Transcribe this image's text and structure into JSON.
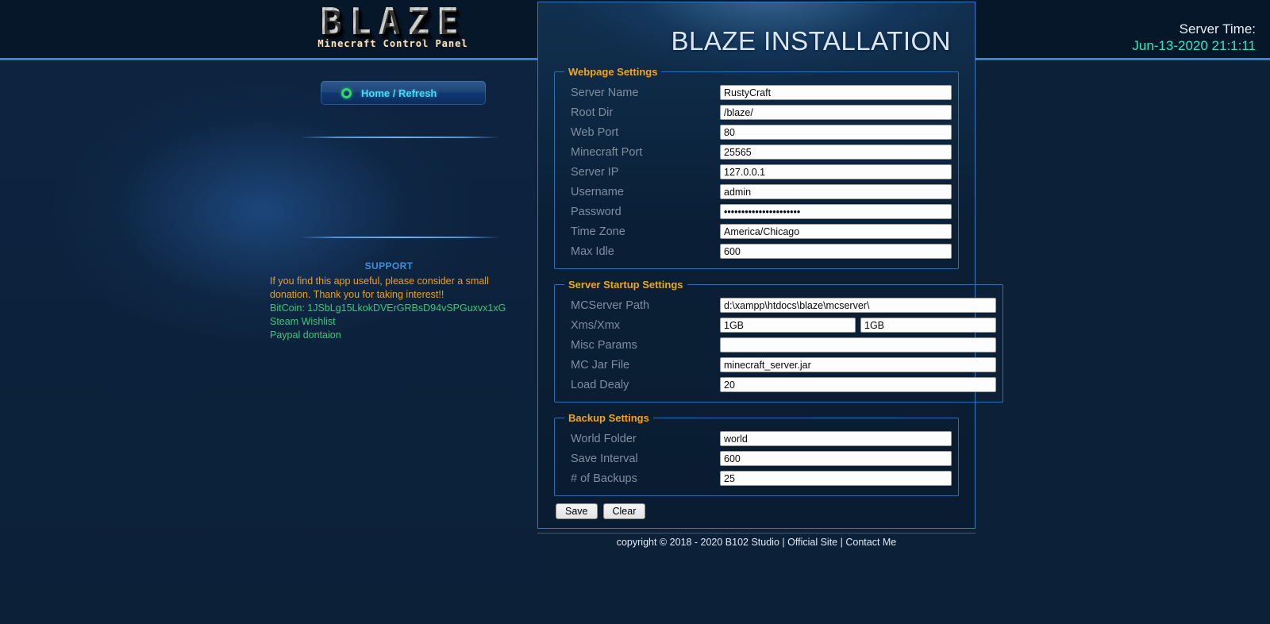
{
  "header": {
    "logo_main": "BLAZE",
    "logo_sub": "Minecraft Control Panel",
    "server_time_label": "Server Time:",
    "server_time_value": "Jun-13-2020 21:1:11"
  },
  "sidebar": {
    "nav": {
      "home_label": "Home / Refresh",
      "home_icon": "green-circle-icon"
    },
    "support": {
      "title": "SUPPORT",
      "note_line1": "If you find this app useful, please consider a small",
      "note_line2": "donation. Thank you for taking interest!!",
      "bitcoin": "BitCoin: 1JSbLg15LkokDVErGRBsD94vSPGuxvx1xG",
      "steam_link": "Steam Wishlist",
      "paypal_link": "Paypal dontaion"
    }
  },
  "main": {
    "title": "BLAZE INSTALLATION",
    "groups": [
      {
        "legend": "Webpage Settings",
        "rows": [
          {
            "label": "Server Name",
            "value": "RustyCraft"
          },
          {
            "label": "Root Dir",
            "value": "/blaze/"
          },
          {
            "label": "Web Port",
            "value": "80"
          },
          {
            "label": "Minecraft Port",
            "value": "25565"
          },
          {
            "label": "Server IP",
            "value": "127.0.0.1"
          },
          {
            "label": "Username",
            "value": "admin"
          },
          {
            "label": "Password",
            "value": "••••••••••••••••••••••"
          },
          {
            "label": "Time Zone",
            "value": "America/Chicago"
          },
          {
            "label": "Max Idle",
            "value": "600"
          }
        ]
      },
      {
        "legend": "Server Startup Settings",
        "rows": [
          {
            "label": "MCServer Path",
            "value": "d:\\xampp\\htdocs\\blaze\\mcserver\\"
          },
          {
            "label": "Xms/Xmx",
            "value": "1GB",
            "value2": "1GB"
          },
          {
            "label": "Misc Params",
            "value": ""
          },
          {
            "label": "MC Jar File",
            "value": "minecraft_server.jar"
          },
          {
            "label": "Load Dealy",
            "value": "20"
          }
        ]
      },
      {
        "legend": "Backup Settings",
        "rows": [
          {
            "label": "World Folder",
            "value": "world"
          },
          {
            "label": "Save Interval",
            "value": "600"
          },
          {
            "label": "# of Backups",
            "value": "25"
          }
        ]
      }
    ],
    "buttons": {
      "save": "Save",
      "clear": "Clear"
    }
  },
  "footer": {
    "copyright": "copyright © 2018 - 2020 B102 Studio |",
    "official_site": "Official Site",
    "separator": "|",
    "contact": "Contact Me"
  },
  "colors": {
    "accent_blue": "#3b79bf",
    "legend_orange": "#f0a51d",
    "support_orange": "#e9a020",
    "support_green": "#38c878",
    "time_cyan": "#2fe6c8",
    "nav_cyan": "#4fd6f2",
    "page_bg": "#0c2138"
  }
}
